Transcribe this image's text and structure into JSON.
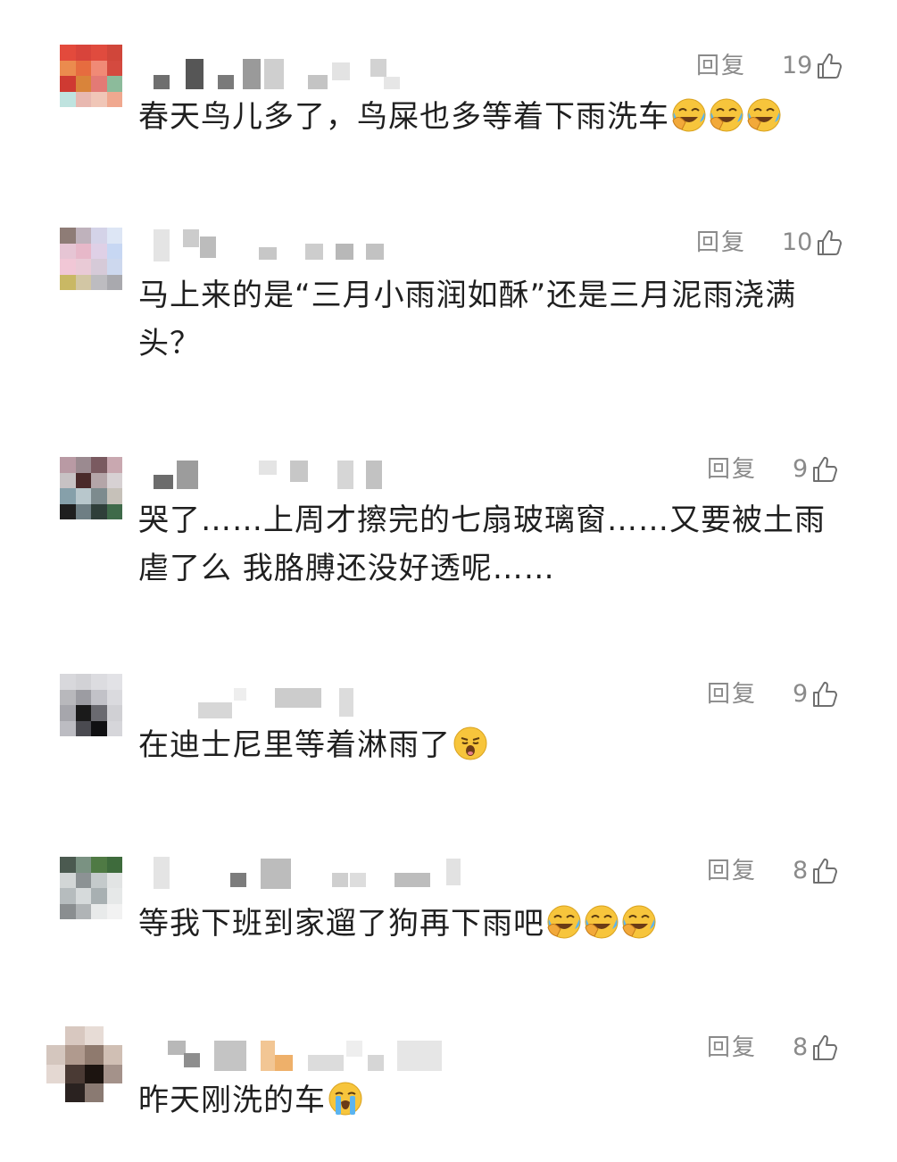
{
  "comments": [
    {
      "reply_label": "回复",
      "like_count": "19",
      "text": "春天鸟儿多了，鸟屎也多等着下雨洗车",
      "emojis": [
        "laughing-crying-emoji",
        "laughing-crying-emoji",
        "laughing-crying-emoji"
      ]
    },
    {
      "reply_label": "回复",
      "like_count": "10",
      "text": "马上来的是“三月小雨润如酥”还是三月泥雨浇满头？",
      "emojis": []
    },
    {
      "reply_label": "回复",
      "like_count": "9",
      "text": "哭了……上周才擦完的七扇玻璃窗……又要被土雨虐了么 我胳膊还没好透呢……",
      "emojis": []
    },
    {
      "reply_label": "回复",
      "like_count": "9",
      "text": "在迪士尼里等着淋雨了",
      "emojis": [
        "yawning-emoji"
      ]
    },
    {
      "reply_label": "回复",
      "like_count": "8",
      "text": "等我下班到家遛了狗再下雨吧",
      "emojis": [
        "laughing-crying-emoji",
        "laughing-crying-emoji",
        "laughing-crying-emoji"
      ]
    },
    {
      "reply_label": "回复",
      "like_count": "8",
      "text": "昨天刚洗的车",
      "emojis": [
        "loudly-crying-emoji"
      ]
    }
  ],
  "icons": {
    "like": "thumbs-up-outline-icon"
  },
  "colors": {
    "meta_text": "#8a8a8a",
    "body_text": "#1f1f1f",
    "emoji_face": "#f7c53c"
  }
}
